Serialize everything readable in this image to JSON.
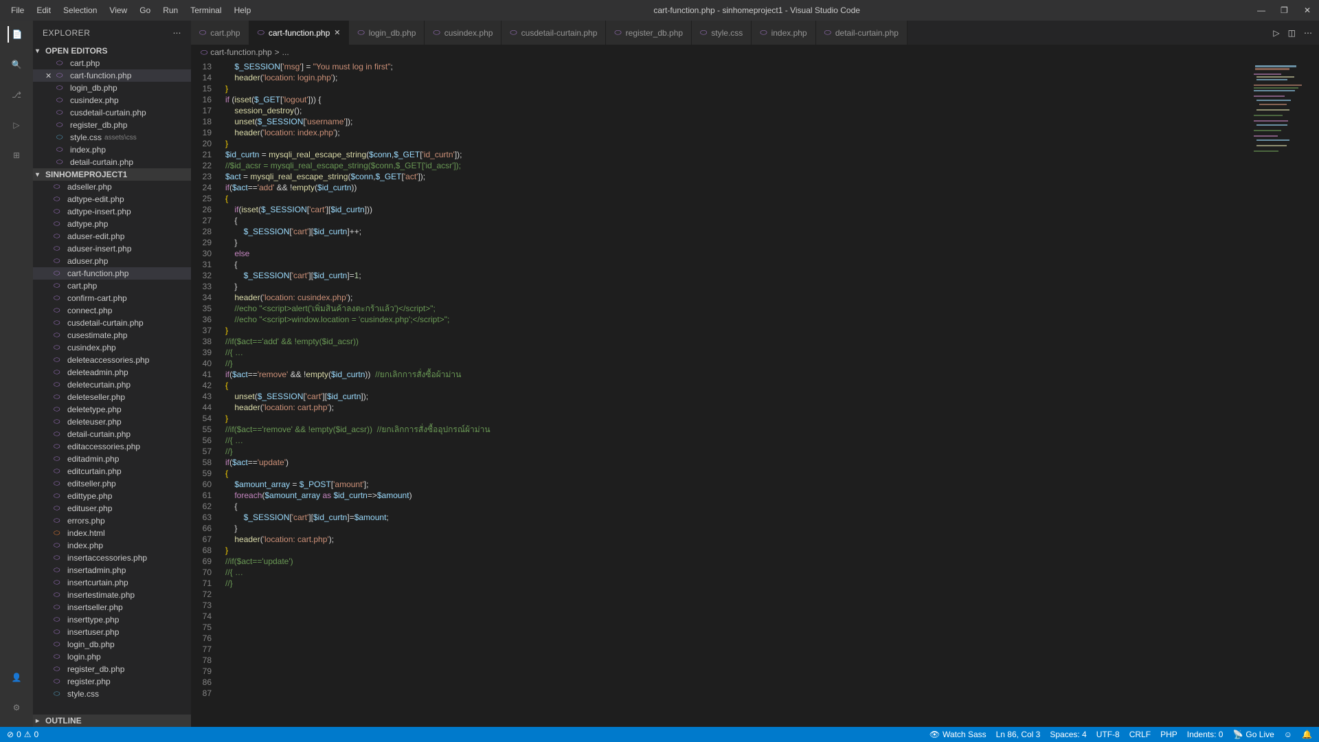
{
  "title": "cart-function.php - sinhomeproject1 - Visual Studio Code",
  "menu": [
    "File",
    "Edit",
    "Selection",
    "View",
    "Go",
    "Run",
    "Terminal",
    "Help"
  ],
  "explorer_title": "EXPLORER",
  "open_editors_label": "OPEN EDITORS",
  "project_label": "SINHOMEPROJECT1",
  "outline_label": "OUTLINE",
  "open_editors": [
    {
      "name": "cart.php",
      "icon": "php"
    },
    {
      "name": "cart-function.php",
      "icon": "php",
      "active": true
    },
    {
      "name": "login_db.php",
      "icon": "php"
    },
    {
      "name": "cusindex.php",
      "icon": "php"
    },
    {
      "name": "cusdetail-curtain.php",
      "icon": "php"
    },
    {
      "name": "register_db.php",
      "icon": "php"
    },
    {
      "name": "style.css",
      "icon": "css",
      "path": "assets\\css"
    },
    {
      "name": "index.php",
      "icon": "php"
    },
    {
      "name": "detail-curtain.php",
      "icon": "php"
    }
  ],
  "files": [
    {
      "name": "adseller.php",
      "icon": "php"
    },
    {
      "name": "adtype-edit.php",
      "icon": "php"
    },
    {
      "name": "adtype-insert.php",
      "icon": "php"
    },
    {
      "name": "adtype.php",
      "icon": "php"
    },
    {
      "name": "aduser-edit.php",
      "icon": "php"
    },
    {
      "name": "aduser-insert.php",
      "icon": "php"
    },
    {
      "name": "aduser.php",
      "icon": "php"
    },
    {
      "name": "cart-function.php",
      "icon": "php",
      "active": true
    },
    {
      "name": "cart.php",
      "icon": "php"
    },
    {
      "name": "confirm-cart.php",
      "icon": "php"
    },
    {
      "name": "connect.php",
      "icon": "php"
    },
    {
      "name": "cusdetail-curtain.php",
      "icon": "php"
    },
    {
      "name": "cusestimate.php",
      "icon": "php"
    },
    {
      "name": "cusindex.php",
      "icon": "php"
    },
    {
      "name": "deleteaccessories.php",
      "icon": "php"
    },
    {
      "name": "deleteadmin.php",
      "icon": "php"
    },
    {
      "name": "deletecurtain.php",
      "icon": "php"
    },
    {
      "name": "deleteseller.php",
      "icon": "php"
    },
    {
      "name": "deletetype.php",
      "icon": "php"
    },
    {
      "name": "deleteuser.php",
      "icon": "php"
    },
    {
      "name": "detail-curtain.php",
      "icon": "php"
    },
    {
      "name": "editaccessories.php",
      "icon": "php"
    },
    {
      "name": "editadmin.php",
      "icon": "php"
    },
    {
      "name": "editcurtain.php",
      "icon": "php"
    },
    {
      "name": "editseller.php",
      "icon": "php"
    },
    {
      "name": "edittype.php",
      "icon": "php"
    },
    {
      "name": "edituser.php",
      "icon": "php"
    },
    {
      "name": "errors.php",
      "icon": "php"
    },
    {
      "name": "index.html",
      "icon": "html"
    },
    {
      "name": "index.php",
      "icon": "php"
    },
    {
      "name": "insertaccessories.php",
      "icon": "php"
    },
    {
      "name": "insertadmin.php",
      "icon": "php"
    },
    {
      "name": "insertcurtain.php",
      "icon": "php"
    },
    {
      "name": "insertestimate.php",
      "icon": "php"
    },
    {
      "name": "insertseller.php",
      "icon": "php"
    },
    {
      "name": "inserttype.php",
      "icon": "php"
    },
    {
      "name": "insertuser.php",
      "icon": "php"
    },
    {
      "name": "login_db.php",
      "icon": "php"
    },
    {
      "name": "login.php",
      "icon": "php"
    },
    {
      "name": "register_db.php",
      "icon": "php"
    },
    {
      "name": "register.php",
      "icon": "php"
    },
    {
      "name": "style.css",
      "icon": "css"
    }
  ],
  "tabs": [
    {
      "name": "cart.php"
    },
    {
      "name": "cart-function.php",
      "active": true
    },
    {
      "name": "login_db.php"
    },
    {
      "name": "cusindex.php"
    },
    {
      "name": "cusdetail-curtain.php"
    },
    {
      "name": "register_db.php"
    },
    {
      "name": "style.css"
    },
    {
      "name": "index.php"
    },
    {
      "name": "detail-curtain.php"
    }
  ],
  "breadcrumb": {
    "file": "cart-function.php",
    "sep": ">",
    "rest": "..."
  },
  "line_numbers": [
    "13",
    "14",
    "15",
    "16",
    "17",
    "18",
    "19",
    "20",
    "21",
    "22",
    "23",
    "24",
    "25",
    "26",
    "27",
    "28",
    "29",
    "30",
    "31",
    "32",
    "33",
    "34",
    "35",
    "36",
    "37",
    "38",
    "39",
    "40",
    "41",
    "42",
    "43",
    "44",
    "54",
    "55",
    "56",
    "57",
    "58",
    "59",
    "60",
    "61",
    "62",
    "63",
    "66",
    "67",
    "68",
    "69",
    "70",
    "71",
    "72",
    "73",
    "74",
    "75",
    "76",
    "77",
    "78",
    "79",
    "86",
    "87"
  ],
  "code_lines": [
    "    <span class='tok-var'>$_SESSION</span>[<span class='tok-string'>'msg'</span>] = <span class='tok-string'>\"You must log in first\"</span>;",
    "    <span class='tok-func'>header</span>(<span class='tok-string'>'location: login.php'</span>);",
    "<span class='tok-bracket'>}</span>",
    "",
    "<span class='tok-keyword'>if</span> (<span class='tok-func'>isset</span>(<span class='tok-var'>$_GET</span>[<span class='tok-string'>'logout'</span>])) {",
    "    <span class='tok-func'>session_destroy</span>();",
    "    <span class='tok-func'>unset</span>(<span class='tok-var'>$_SESSION</span>[<span class='tok-string'>'username'</span>]);",
    "    <span class='tok-func'>header</span>(<span class='tok-string'>'location: index.php'</span>);",
    "<span class='tok-bracket'>}</span>",
    "",
    "",
    "<span class='tok-var'>$id_curtn</span> = <span class='tok-func'>mysqli_real_escape_string</span>(<span class='tok-var'>$conn</span>,<span class='tok-var'>$_GET</span>[<span class='tok-string'>'id_curtn'</span>]);",
    "<span class='tok-comment'>//$id_acsr = mysqli_real_escape_string($conn,$_GET['id_acsr']);</span>",
    "<span class='tok-var'>$act</span> = <span class='tok-func'>mysqli_real_escape_string</span>(<span class='tok-var'>$conn</span>,<span class='tok-var'>$_GET</span>[<span class='tok-string'>'act'</span>]);",
    "",
    "<span class='tok-keyword'>if</span>(<span class='tok-var'>$act</span>==<span class='tok-string'>'add'</span> && !<span class='tok-func'>empty</span>(<span class='tok-var'>$id_curtn</span>))",
    "<span class='tok-bracket'>{</span>",
    "    <span class='tok-keyword'>if</span>(<span class='tok-func'>isset</span>(<span class='tok-var'>$_SESSION</span>[<span class='tok-string'>'cart'</span>][<span class='tok-var'>$id_curtn</span>]))",
    "    {",
    "        <span class='tok-var'>$_SESSION</span>[<span class='tok-string'>'cart'</span>][<span class='tok-var'>$id_curtn</span>]++;",
    "    }",
    "    <span class='tok-keyword'>else</span>",
    "    {",
    "        <span class='tok-var'>$_SESSION</span>[<span class='tok-string'>'cart'</span>][<span class='tok-var'>$id_curtn</span>]=<span class='tok-num'>1</span>;",
    "    }",
    "    <span class='tok-func'>header</span>(<span class='tok-string'>'location: cusindex.php'</span>);",
    "    <span class='tok-comment'>//echo \"&lt;script&gt;alert('เพิ่มสินค้าลงตะกร้าแล้ว')&lt;/script&gt;\";</span>",
    "    <span class='tok-comment'>//echo \"&lt;script&gt;window.location = 'cusindex.php';&lt;/script&gt;\";</span>",
    "<span class='tok-bracket'>}</span>",
    "",
    "<span class='tok-comment'>//if($act=='add' && !empty($id_acsr))</span>",
    "<span class='tok-comment'>//{ …</span>",
    "<span class='tok-comment'>//}</span>",
    "",
    "<span class='tok-keyword'>if</span>(<span class='tok-var'>$act</span>==<span class='tok-string'>'remove'</span> && !<span class='tok-func'>empty</span>(<span class='tok-var'>$id_curtn</span>))  <span class='tok-comment'>//ยกเลิกการสั่งซื้อผ้าม่าน</span>",
    "<span class='tok-bracket'>{</span>",
    "    <span class='tok-func'>unset</span>(<span class='tok-var'>$_SESSION</span>[<span class='tok-string'>'cart'</span>][<span class='tok-var'>$id_curtn</span>]);",
    "    <span class='tok-func'>header</span>(<span class='tok-string'>'location: cart.php'</span>);",
    "<span class='tok-bracket'>}</span>",
    "",
    "<span class='tok-comment'>//if($act=='remove' && !empty($id_acsr))  //ยกเลิกการสั่งซื้ออุปกรณ์ผ้าม่าน</span>",
    "<span class='tok-comment'>//{ …</span>",
    "<span class='tok-comment'>//}</span>",
    "",
    "<span class='tok-keyword'>if</span>(<span class='tok-var'>$act</span>==<span class='tok-string'>'update'</span>)",
    "<span class='tok-bracket'>{</span>",
    "    <span class='tok-var'>$amount_array</span> = <span class='tok-var'>$_POST</span>[<span class='tok-string'>'amount'</span>];",
    "    <span class='tok-keyword'>foreach</span>(<span class='tok-var'>$amount_array</span> <span class='tok-keyword'>as</span> <span class='tok-var'>$id_curtn</span>=&gt;<span class='tok-var'>$amount</span>)",
    "    {",
    "        <span class='tok-var'>$_SESSION</span>[<span class='tok-string'>'cart'</span>][<span class='tok-var'>$id_curtn</span>]=<span class='tok-var'>$amount</span>;",
    "    }",
    "    <span class='tok-func'>header</span>(<span class='tok-string'>'location: cart.php'</span>);",
    "<span class='tok-bracket'>}</span>",
    "",
    "<span class='tok-comment'>//if($act=='update')</span>",
    "<span class='tok-comment'>//{ …</span>",
    "<span class='tok-comment'>//}</span>",
    ""
  ],
  "status": {
    "errors": "0",
    "warnings": "0",
    "watch_sass": "Watch Sass",
    "lncol": "Ln 86, Col 3",
    "spaces": "Spaces: 4",
    "encoding": "UTF-8",
    "eol": "CRLF",
    "lang": "PHP",
    "indents": "Indents: 0",
    "golive": "Go Live",
    "bell": "🔔"
  }
}
